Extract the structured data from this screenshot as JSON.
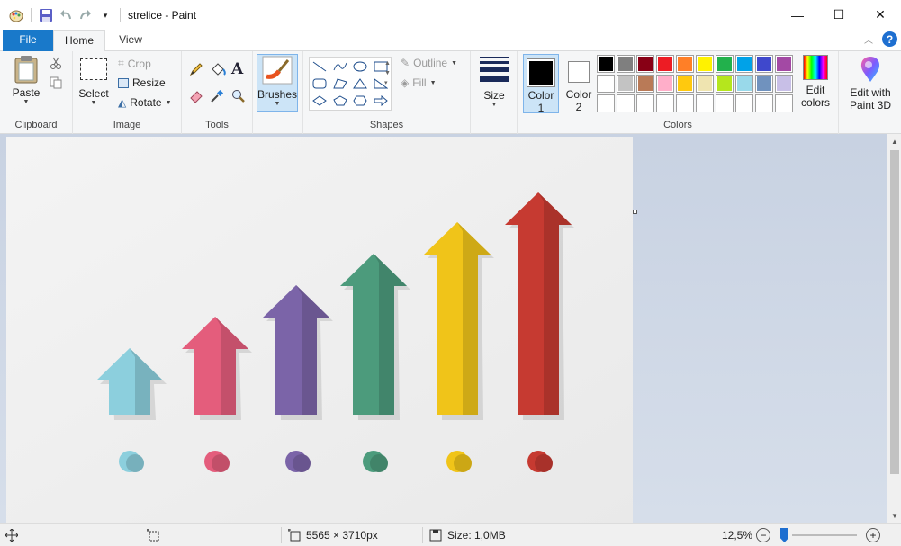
{
  "window": {
    "title": "strelice - Paint",
    "controls": {
      "minimize": "—",
      "maximize": "☐",
      "close": "✕"
    }
  },
  "tabs": [
    {
      "label": "File",
      "active": false
    },
    {
      "label": "Home",
      "active": true
    },
    {
      "label": "View",
      "active": false
    }
  ],
  "ribbon": {
    "clipboard": {
      "group_label": "Clipboard",
      "paste_label": "Paste"
    },
    "image": {
      "group_label": "Image",
      "select_label": "Select",
      "crop_label": "Crop",
      "resize_label": "Resize",
      "rotate_label": "Rotate"
    },
    "tools": {
      "group_label": "Tools"
    },
    "brushes": {
      "label": "Brushes"
    },
    "shapes": {
      "group_label": "Shapes",
      "outline_label": "Outline",
      "fill_label": "Fill"
    },
    "size": {
      "label": "Size"
    },
    "colors": {
      "group_label": "Colors",
      "color1_label": "Color",
      "color1_num": "1",
      "color2_label": "Color",
      "color2_num": "2",
      "color1_value": "#000000",
      "color2_value": "#ffffff",
      "palette_row1": [
        "#000000",
        "#7f7f7f",
        "#880015",
        "#ed1c24",
        "#ff7f27",
        "#fff200",
        "#22b14c",
        "#00a2e8",
        "#3f48cc",
        "#a349a4"
      ],
      "palette_row2": [
        "#ffffff",
        "#c3c3c3",
        "#b97a57",
        "#ffaec9",
        "#ffc90e",
        "#efe4b0",
        "#b5e61d",
        "#99d9ea",
        "#7092be",
        "#c8bfe7"
      ],
      "palette_row3": [
        "#ffffff",
        "#ffffff",
        "#ffffff",
        "#ffffff",
        "#ffffff",
        "#ffffff",
        "#ffffff",
        "#ffffff",
        "#ffffff",
        "#ffffff"
      ],
      "edit_colors_line1": "Edit",
      "edit_colors_line2": "colors"
    },
    "paint3d": {
      "line1": "Edit with",
      "line2": "Paint 3D"
    }
  },
  "canvas": {
    "image_description_colors": [
      "#8ccfdd",
      "#e45d7c",
      "#7b64a8",
      "#4c9b7c",
      "#f0c419",
      "#c63a31"
    ]
  },
  "status": {
    "dimensions": "5565 × 3710px",
    "size": "Size: 1,0MB",
    "zoom": "12,5%",
    "zoom_level": 0.0
  }
}
